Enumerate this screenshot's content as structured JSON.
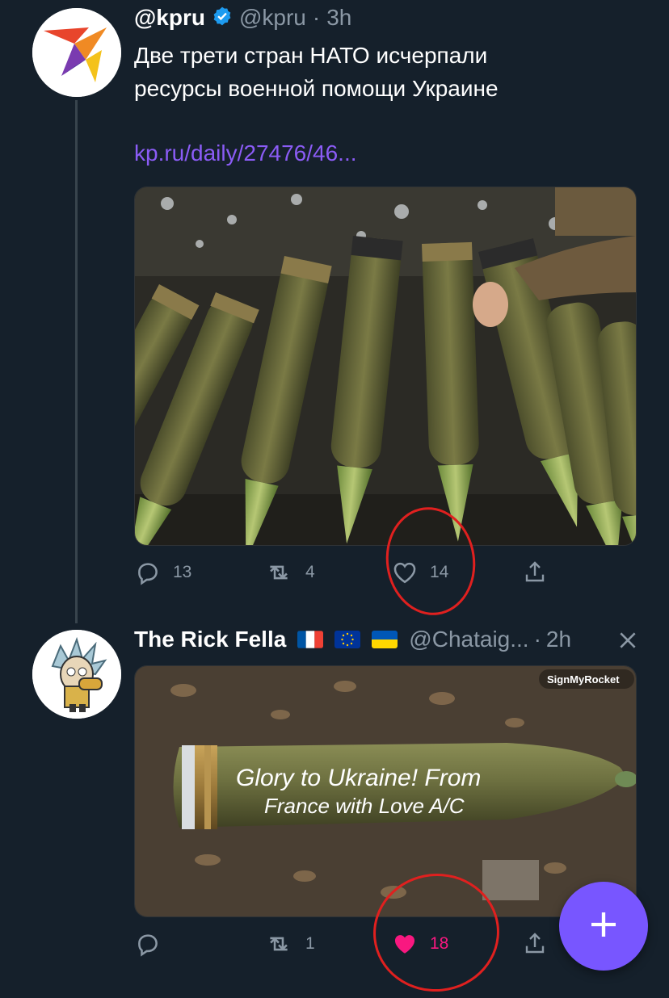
{
  "tweet1": {
    "name": "@kpru",
    "handle": "@kpru",
    "separator": "·",
    "time": "3h",
    "text_line1": "Две трети стран НАТО исчерпали",
    "text_line2": "ресурсы военной помощи Украине",
    "link": "kp.ru/daily/27476/46...",
    "replies": "13",
    "retweets": "4",
    "likes": "14"
  },
  "tweet2": {
    "name": "The Rick Fella",
    "handle": "@Chataig...",
    "separator": "·",
    "time": "2h",
    "media_watermark": "SignMyRocket",
    "shell_text_line1": "Glory to Ukraine! From",
    "shell_text_line2": "France with Love A/C",
    "replies": "",
    "retweets": "1",
    "likes": "18"
  },
  "colors": {
    "background": "#15202b",
    "accent_link": "#8b5cf6",
    "liked_pink": "#f91880",
    "fab": "#7856ff",
    "verified": "#1d9bf0",
    "annotation_red": "#e0201f"
  }
}
